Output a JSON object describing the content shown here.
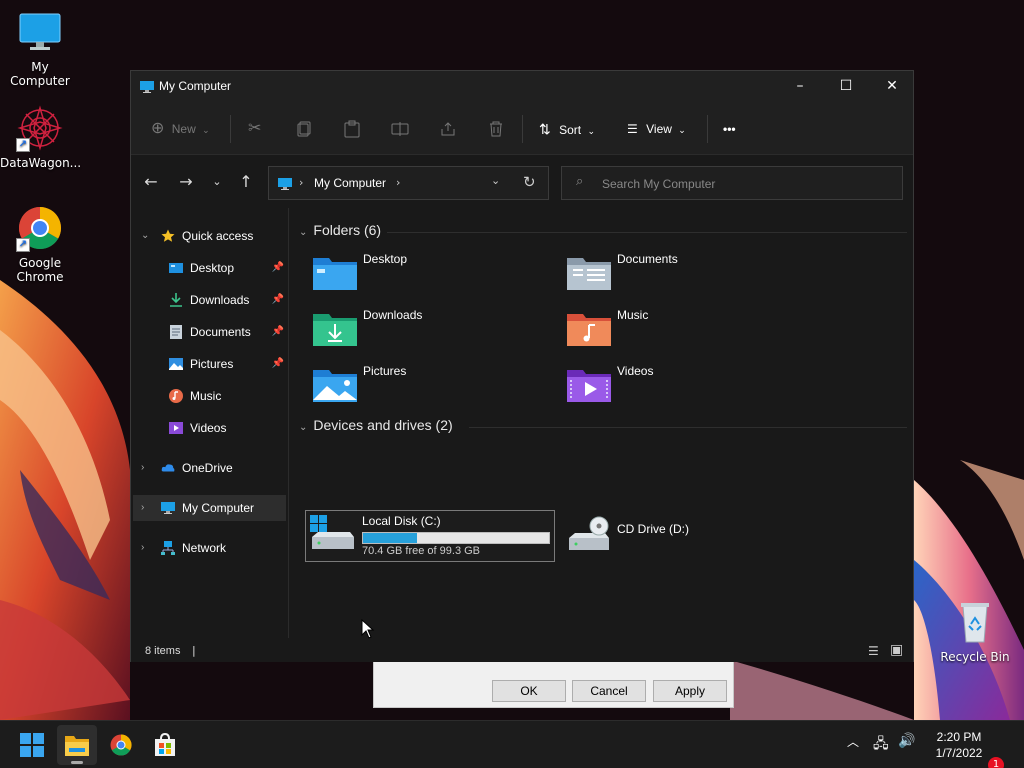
{
  "desktop": {
    "icons": [
      {
        "label": "My Computer",
        "icon": "monitor-icon"
      },
      {
        "label": "DataWagon...",
        "icon": "mandala-icon"
      },
      {
        "label": "Google Chrome",
        "icon": "chrome-icon"
      },
      {
        "label": "Recycle Bin",
        "icon": "recycle-bin-icon"
      }
    ]
  },
  "dialog": {
    "ok_label": "OK",
    "cancel_label": "Cancel",
    "apply_label": "Apply"
  },
  "window": {
    "title": "My Computer",
    "controls": {
      "minimize": "–",
      "maximize": "☐",
      "close": "✕"
    },
    "commandbar": {
      "new_label": "New",
      "sort_label": "Sort",
      "view_label": "View",
      "more_label": "•••"
    },
    "address": {
      "location": "My Computer"
    },
    "search": {
      "placeholder": "Search My Computer"
    },
    "sidebar": {
      "quick_access": "Quick access",
      "quick_items": [
        {
          "label": "Desktop",
          "icon": "desktop-folder-icon"
        },
        {
          "label": "Downloads",
          "icon": "downloads-icon"
        },
        {
          "label": "Documents",
          "icon": "documents-icon"
        },
        {
          "label": "Pictures",
          "icon": "pictures-icon"
        },
        {
          "label": "Music",
          "icon": "music-icon"
        },
        {
          "label": "Videos",
          "icon": "videos-icon"
        }
      ],
      "onedrive": "OneDrive",
      "my_computer": "My Computer",
      "network": "Network"
    },
    "content": {
      "folders_header": "Folders (6)",
      "folders": [
        {
          "name": "Desktop",
          "icon": "desktop-folder-icon"
        },
        {
          "name": "Documents",
          "icon": "documents-folder-icon"
        },
        {
          "name": "Downloads",
          "icon": "downloads-folder-icon"
        },
        {
          "name": "Music",
          "icon": "music-folder-icon"
        },
        {
          "name": "Pictures",
          "icon": "pictures-folder-icon"
        },
        {
          "name": "Videos",
          "icon": "videos-folder-icon"
        }
      ],
      "drives_header": "Devices and drives (2)",
      "drives": [
        {
          "name": "Local Disk (C:)",
          "free_text": "70.4 GB free of 99.3 GB",
          "used_fraction": 0.29,
          "icon": "hard-drive-icon"
        },
        {
          "name": "CD Drive (D:)",
          "icon": "cd-drive-icon"
        }
      ]
    },
    "status": {
      "items": "8 items"
    }
  },
  "taskbar": {
    "apps": [
      "start-icon",
      "file-explorer-icon",
      "chrome-icon",
      "store-icon"
    ],
    "clock_time": "2:20 PM",
    "clock_date": "1/7/2022",
    "notification_count": "1"
  },
  "colors": {
    "accent": "#26a0da",
    "window_bg": "#191919",
    "titlebar_bg": "#202020",
    "folder_blue": "#3a9ee8"
  }
}
